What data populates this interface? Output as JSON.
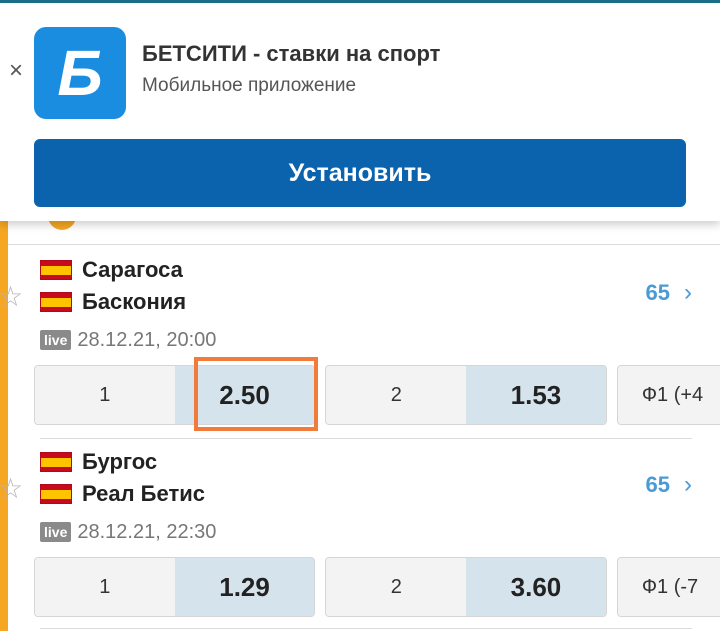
{
  "banner": {
    "app_icon_letter": "Б",
    "app_name": "БЕТСИТИ - ставки на спорт",
    "app_subtitle": "Мобильное приложение",
    "install_label": "Установить",
    "close_icon": "×"
  },
  "matches": [
    {
      "team1": "Сарагоса",
      "team2": "Баскония",
      "markets": "65",
      "live": "live",
      "datetime": "28.12.21, 20:00",
      "odds": [
        {
          "label": "1",
          "value": "2.50"
        },
        {
          "label": "2",
          "value": "1.53"
        }
      ],
      "extra": "Ф1 (+4"
    },
    {
      "team1": "Бургос",
      "team2": "Реал Бетис",
      "markets": "65",
      "live": "live",
      "datetime": "28.12.21, 22:30",
      "odds": [
        {
          "label": "1",
          "value": "1.29"
        },
        {
          "label": "2",
          "value": "3.60"
        }
      ],
      "extra": "Ф1 (-7"
    }
  ],
  "icons": {
    "star": "☆",
    "chevron": "›"
  },
  "colors": {
    "accent": "#f5a623",
    "install_button": "#0b62ad",
    "app_icon": "#1a8de0",
    "highlight": "#f07b3a",
    "markets_link": "#4a9ad4"
  }
}
